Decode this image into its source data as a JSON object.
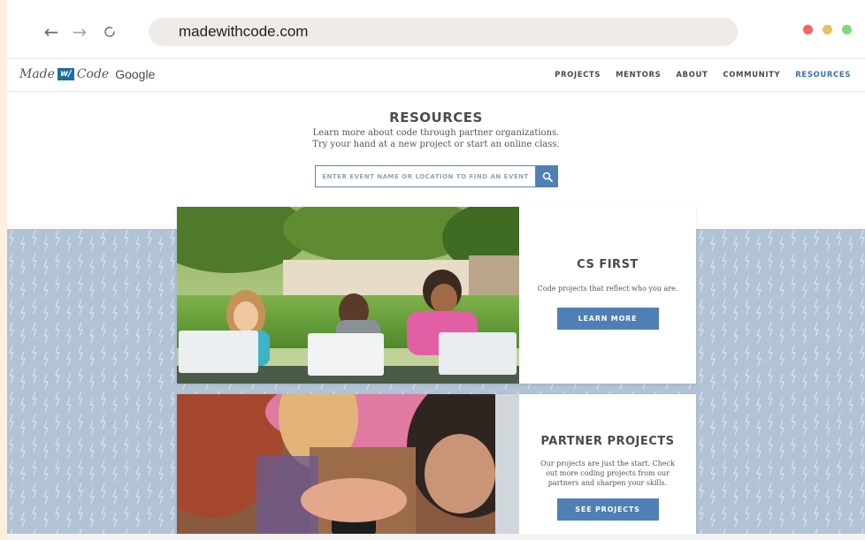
{
  "browser": {
    "url": "madewithcode.com",
    "back_glyph": "←",
    "forward_glyph": "→",
    "reload_glyph": "○"
  },
  "site": {
    "logo": {
      "made": "Made",
      "with": "w/",
      "code": "Code",
      "google": "Google"
    },
    "menu": [
      {
        "label": "PROJECTS"
      },
      {
        "label": "MENTORS"
      },
      {
        "label": "ABOUT"
      },
      {
        "label": "COMMUNITY"
      },
      {
        "label": "RESOURCES",
        "active": true
      }
    ]
  },
  "resources": {
    "title": "RESOURCES",
    "subtitle_line1": "Learn more about code through partner organizations.",
    "subtitle_line2": "Try your hand at a new project or start an online class.",
    "search_placeholder": "ENTER EVENT NAME OR LOCATION TO FIND AN EVENT"
  },
  "cards": [
    {
      "title": "CS FIRST",
      "text": "Code projects that reflect who you are.",
      "button": "LEARN MORE"
    },
    {
      "title": "PARTNER PROJECTS",
      "text": "Our projects are just the start. Check out more coding projects from our partners and sharpen your skills.",
      "button": "SEE PROJECTS"
    }
  ],
  "colors": {
    "accent": "#4f7fb5",
    "pattern_bg": "#b2c3d6",
    "page_bg": "#fdeede"
  }
}
